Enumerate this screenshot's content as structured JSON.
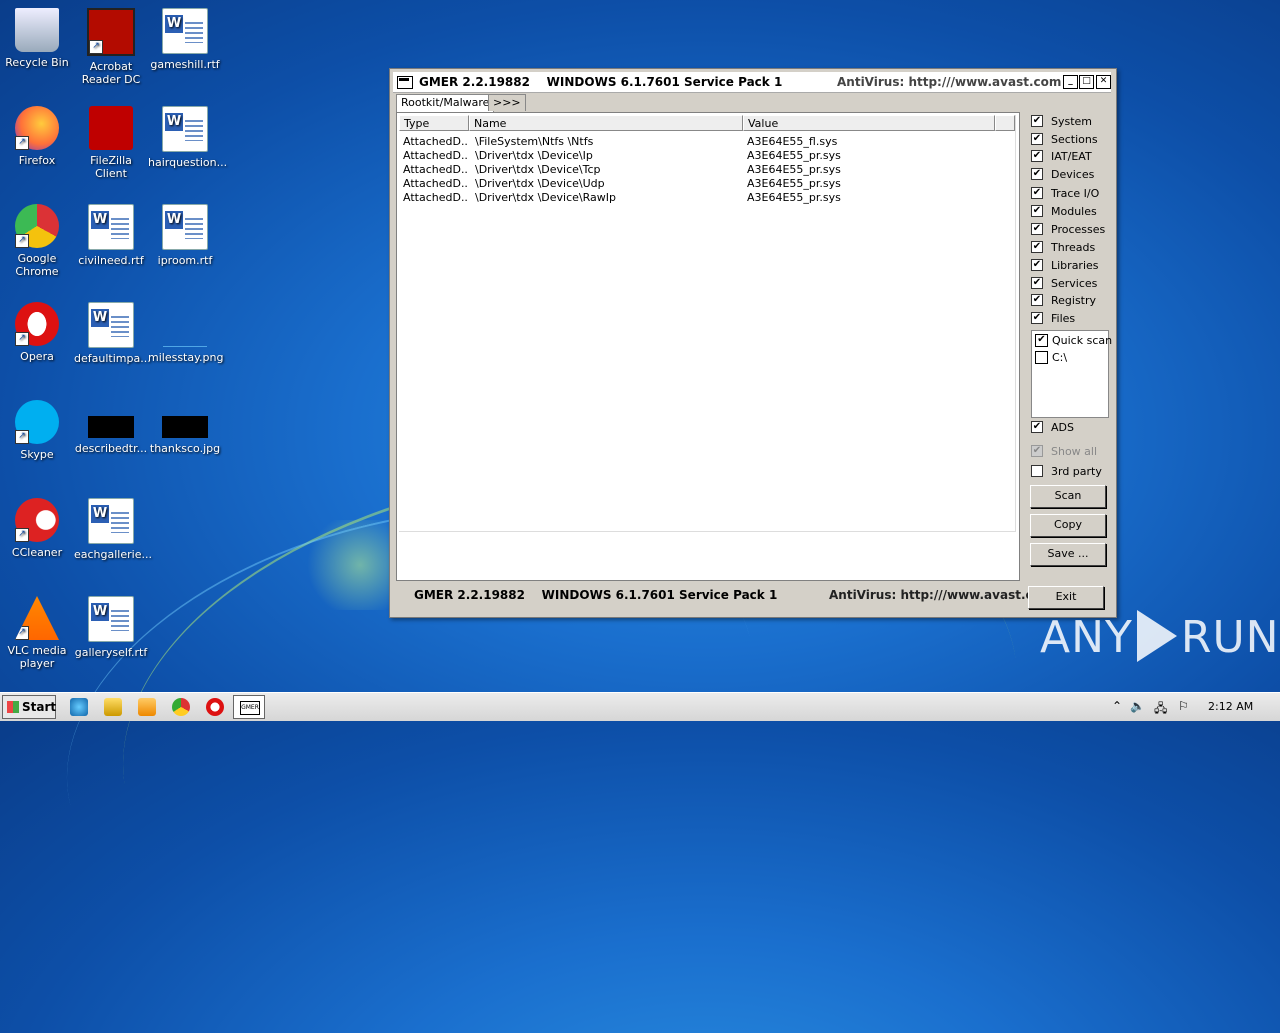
{
  "desktop": {
    "icons": [
      {
        "label": "Recycle Bin",
        "icon": "recycle-bin-icon"
      },
      {
        "label": "Acrobat Reader DC",
        "icon": "acrobat-icon"
      },
      {
        "label": "gameshill.rtf",
        "icon": "word-doc-icon"
      },
      {
        "label": "Firefox",
        "icon": "firefox-icon"
      },
      {
        "label": "FileZilla Client",
        "icon": "filezilla-icon"
      },
      {
        "label": "hairquestion...",
        "icon": "word-doc-icon"
      },
      {
        "label": "Google Chrome",
        "icon": "chrome-icon"
      },
      {
        "label": "civilneed.rtf",
        "icon": "word-doc-icon"
      },
      {
        "label": "iproom.rtf",
        "icon": "word-doc-icon"
      },
      {
        "label": "Opera",
        "icon": "opera-icon"
      },
      {
        "label": "defaultimpa...",
        "icon": "word-doc-icon"
      },
      {
        "label": "milesstay.png",
        "icon": "image-icon"
      },
      {
        "label": "Skype",
        "icon": "skype-icon"
      },
      {
        "label": "describedtr...",
        "icon": "image-icon"
      },
      {
        "label": "thanksco.jpg",
        "icon": "image-icon"
      },
      {
        "label": "CCleaner",
        "icon": "ccleaner-icon"
      },
      {
        "label": "eachgallerie...",
        "icon": "word-doc-icon"
      },
      {
        "label": "VLC media player",
        "icon": "vlc-icon"
      },
      {
        "label": "galleryself.rtf",
        "icon": "word-doc-icon"
      }
    ]
  },
  "window": {
    "title": "GMER 2.2.19882    WINDOWS 6.1.7601 Service Pack 1",
    "antivirus": "AntiVirus: http:///www.avast.com",
    "tabs": [
      "Rootkit/Malware",
      ">>>"
    ],
    "columns": [
      "Type",
      "Name",
      "Value"
    ],
    "rows": [
      {
        "type": "AttachedD...",
        "name": "\\FileSystem\\Ntfs \\Ntfs",
        "value": "A3E64E55_fl.sys"
      },
      {
        "type": "AttachedD...",
        "name": "\\Driver\\tdx \\Device\\Ip",
        "value": "A3E64E55_pr.sys"
      },
      {
        "type": "AttachedD...",
        "name": "\\Driver\\tdx \\Device\\Tcp",
        "value": "A3E64E55_pr.sys"
      },
      {
        "type": "AttachedD...",
        "name": "\\Driver\\tdx \\Device\\Udp",
        "value": "A3E64E55_pr.sys"
      },
      {
        "type": "AttachedD...",
        "name": "\\Driver\\tdx \\Device\\RawIp",
        "value": "A3E64E55_pr.sys"
      }
    ],
    "options": [
      {
        "label": "System",
        "checked": true
      },
      {
        "label": "Sections",
        "checked": true
      },
      {
        "label": "IAT/EAT",
        "checked": true
      },
      {
        "label": "Devices",
        "checked": true
      },
      {
        "label": "Trace I/O",
        "checked": true
      },
      {
        "label": "Modules",
        "checked": true
      },
      {
        "label": "Processes",
        "checked": true
      },
      {
        "label": "Threads",
        "checked": true
      },
      {
        "label": "Libraries",
        "checked": true
      },
      {
        "label": "Services",
        "checked": true
      },
      {
        "label": "Registry",
        "checked": true
      },
      {
        "label": "Files",
        "checked": true
      }
    ],
    "drives": [
      {
        "label": "Quick scan",
        "checked": true
      },
      {
        "label": "C:\\",
        "checked": false
      }
    ],
    "ads": {
      "label": "ADS",
      "checked": true
    },
    "show_all": {
      "label": "Show all",
      "checked": true,
      "disabled": true
    },
    "third_party": {
      "label": "3rd party",
      "checked": false
    },
    "buttons": {
      "scan": "Scan",
      "copy": "Copy",
      "save": "Save ...",
      "exit": "Exit"
    },
    "status_left": "GMER 2.2.19882    WINDOWS 6.1.7601 Service Pack 1",
    "status_right": "AntiVirus: http:///www.avast.com"
  },
  "watermark": "ANY RUN",
  "taskbar": {
    "start": "Start",
    "clock": "2:12 AM"
  }
}
